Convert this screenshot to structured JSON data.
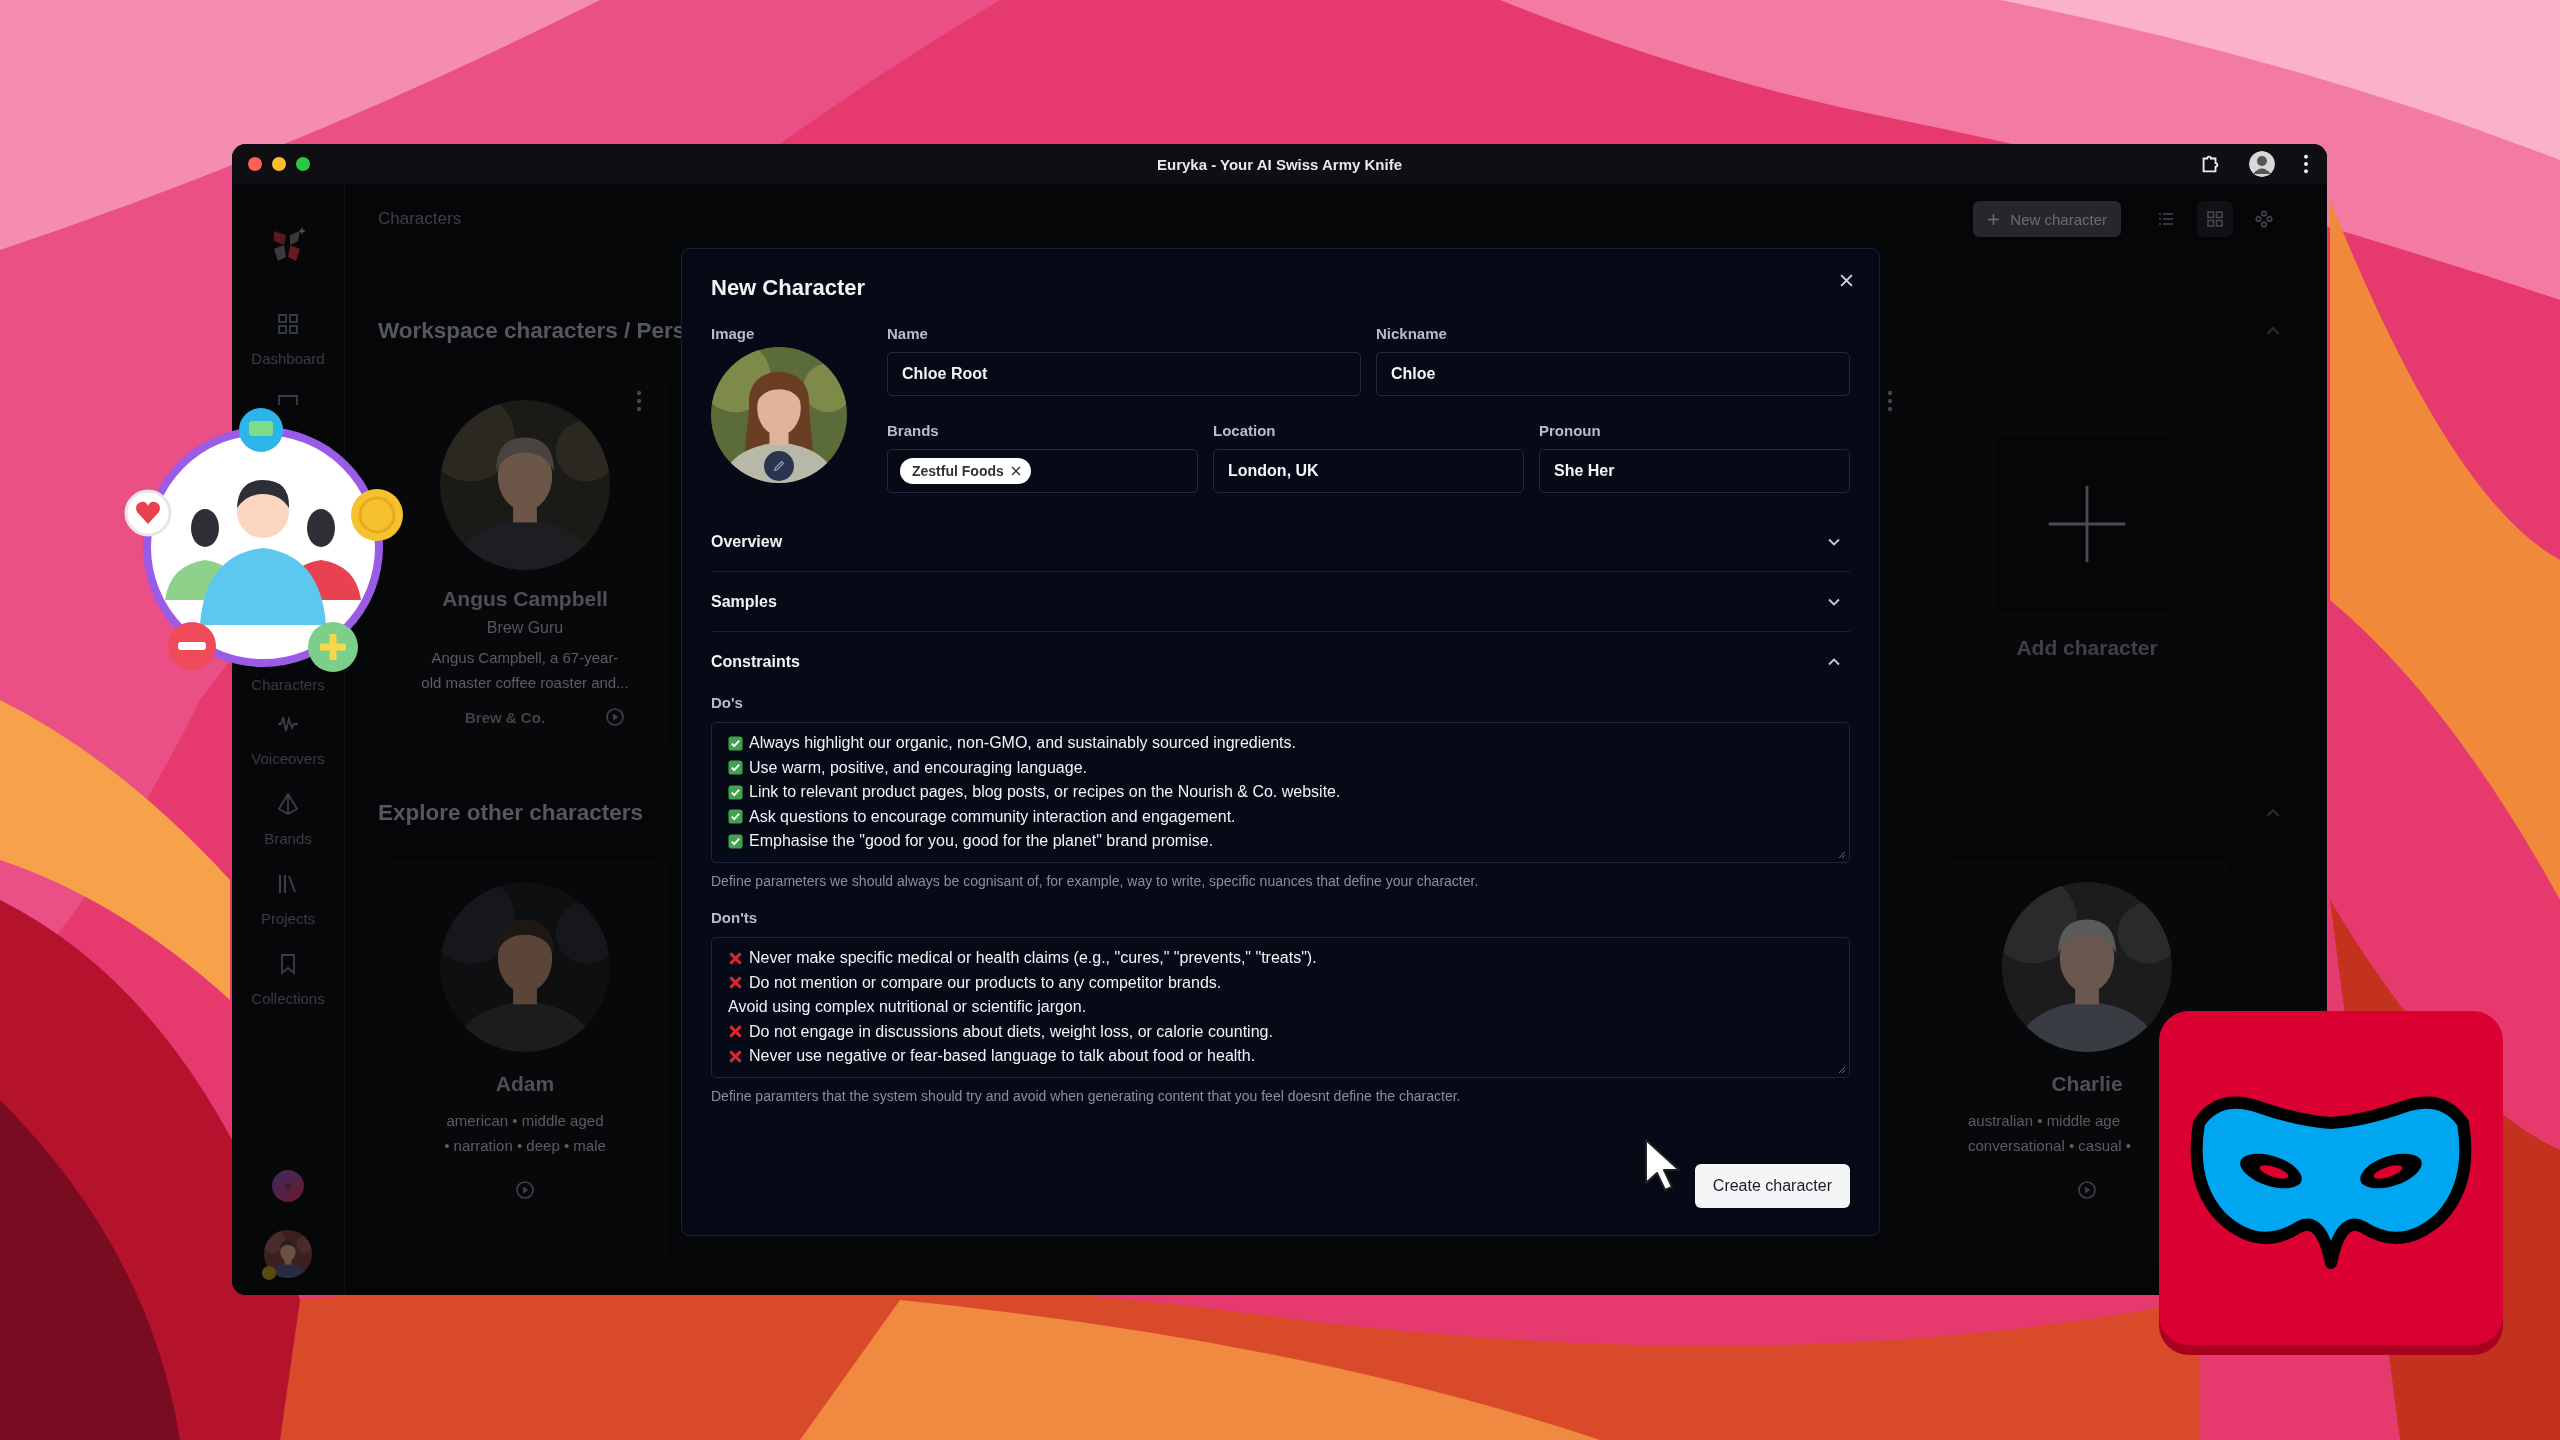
{
  "window": {
    "title": "Euryka - Your AI Swiss Army Knife"
  },
  "sidebar": {
    "items": [
      {
        "label": "Dashboard"
      },
      {
        "label": "Characters"
      },
      {
        "label": "Voiceovers"
      },
      {
        "label": "Brands"
      },
      {
        "label": "Projects"
      },
      {
        "label": "Collections"
      }
    ]
  },
  "header": {
    "title": "Characters",
    "new_button": "New character",
    "view_options": [
      {
        "selected": false
      },
      {
        "selected": true
      },
      {
        "selected": false
      }
    ]
  },
  "workspace": {
    "title": "Workspace characters / Pers",
    "expanded": true,
    "cards": [
      {
        "name": "Angus Campbell",
        "role": "Brew Guru",
        "description_lines": [
          "Angus Campbell, a 67-year-",
          "old master coffee roaster and..."
        ],
        "brand": "Brew & Co."
      }
    ],
    "add_label": "Add character"
  },
  "explore": {
    "title": "Explore other characters",
    "expanded": true,
    "cards": [
      {
        "name": "Adam",
        "tag_lines": [
          "american • middle aged",
          "• narration • deep • male"
        ]
      },
      {
        "name": "Charlie",
        "tag_lines": [
          "australian • middle age",
          "conversational • casual •"
        ]
      }
    ]
  },
  "dialog": {
    "title": "New Character",
    "image_label": "Image",
    "fields": [
      {
        "kind": "text",
        "label": "Name",
        "value": "Chloe Root"
      },
      {
        "kind": "text",
        "label": "Nickname",
        "value": "Chloe"
      },
      {
        "kind": "tags",
        "label": "Brands",
        "tags": [
          "Zestful Foods"
        ]
      },
      {
        "kind": "text",
        "label": "Location",
        "value": "London, UK"
      },
      {
        "kind": "text",
        "label": "Pronoun",
        "value": "She Her"
      }
    ],
    "sections": [
      {
        "title": "Overview",
        "expanded": false
      },
      {
        "title": "Samples",
        "expanded": false
      },
      {
        "title": "Constraints",
        "expanded": true,
        "groups": [
          {
            "label": "Do's",
            "lines": [
              {
                "kind": "check",
                "text": "Always highlight our organic, non-GMO, and sustainably sourced ingredients."
              },
              {
                "kind": "check",
                "text": "Use warm, positive, and encouraging language."
              },
              {
                "kind": "check",
                "text": "Link to relevant product pages, blog posts, or recipes on the Nourish & Co. website."
              },
              {
                "kind": "check",
                "text": "Ask questions to encourage community interaction and engagement."
              },
              {
                "kind": "check",
                "text": "Emphasise the \"good for you, good for the planet\" brand promise."
              }
            ],
            "hint": "Define parameters we should always be cognisant of, for example, way to write, specific nuances that define your character."
          },
          {
            "label": "Don'ts",
            "lines": [
              {
                "kind": "cross",
                "text": "Never make specific medical or health claims (e.g., \"cures,\" \"prevents,\" \"treats\")."
              },
              {
                "kind": "cross",
                "text": "Do not mention or compare our products to any competitor brands."
              },
              {
                "kind": "plain",
                "text": "Avoid using complex nutritional or scientific jargon."
              },
              {
                "kind": "cross",
                "text": "Do not engage in discussions about diets, weight loss, or calorie counting."
              },
              {
                "kind": "cross",
                "text": "Never use negative or fear-based language to talk about food or health."
              }
            ],
            "hint": "Define paramters that the system should try and avoid when generating content that you feel doesnt define the character."
          }
        ]
      }
    ],
    "submit": "Create character"
  }
}
